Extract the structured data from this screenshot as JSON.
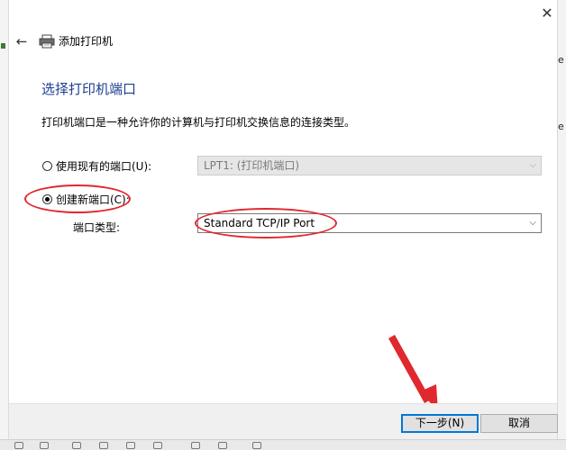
{
  "window": {
    "title": "添加打印机",
    "close_symbol": "✕",
    "back_symbol": "←"
  },
  "page": {
    "heading": "选择打印机端口",
    "description": "打印机端口是一种允许你的计算机与打印机交换信息的连接类型。"
  },
  "options": {
    "existing_port": {
      "label": "使用现有的端口(U):",
      "selected": false,
      "value": "LPT1: (打印机端口)",
      "enabled": false
    },
    "new_port": {
      "label": "创建新端口(C):",
      "selected": true,
      "type_label": "端口类型:",
      "value": "Standard TCP/IP Port"
    }
  },
  "buttons": {
    "next": "下一步(N)",
    "cancel": "取消"
  },
  "colors": {
    "heading": "#1b3f8f",
    "annotation": "#e0282e",
    "default_button_border": "#0078d7",
    "footer_bg": "#f0f0f0"
  },
  "icons": [
    "close-icon",
    "back-arrow-icon",
    "printer-icon",
    "chevron-down-icon",
    "annotation-arrow"
  ]
}
